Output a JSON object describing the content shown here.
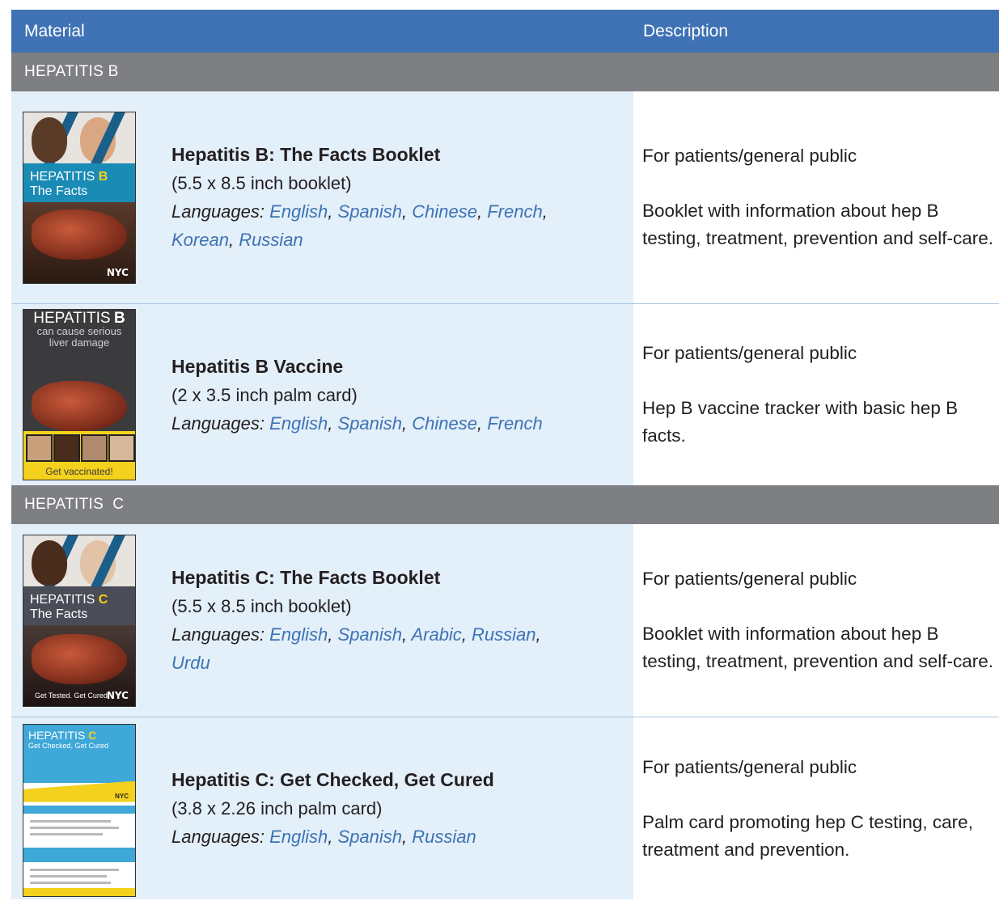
{
  "header": {
    "material": "Material",
    "description": "Description"
  },
  "sections": [
    {
      "label": "HEPATITIS B",
      "rows": [
        {
          "title": "Hepatitis B: The Facts Booklet",
          "format": "(5.5 x 8.5 inch booklet)",
          "languages_label": "Languages:",
          "languages": [
            "English",
            "Spanish",
            "Chinese",
            "French",
            "Korean",
            "Russian"
          ],
          "audience": "For patients/general public",
          "description": "Booklet with information about hep B testing, treatment, prevention and self-care.",
          "thumb": {
            "line1": "HEPATITIS",
            "letter": "B",
            "line2": "The Facts",
            "brand": "NYC"
          }
        },
        {
          "title": "Hepatitis B Vaccine",
          "format": "(2 x 3.5 inch palm card)",
          "languages_label": "Languages:",
          "languages": [
            "English",
            "Spanish",
            "Chinese",
            "French"
          ],
          "audience": "For patients/general public",
          "description": "Hep B vaccine tracker with basic hep B facts.",
          "thumb": {
            "line1": "HEPATITIS",
            "letter": "B",
            "line2": "can cause serious",
            "line3": "liver damage",
            "footer": "Get vaccinated!"
          }
        }
      ]
    },
    {
      "label": "HEPATITIS  C",
      "rows": [
        {
          "title": "Hepatitis C: The Facts Booklet",
          "format": "(5.5 x 8.5 inch booklet)",
          "languages_label": "Languages:",
          "languages": [
            "English",
            "Spanish",
            "Arabic",
            "Russian",
            "Urdu"
          ],
          "audience": "For patients/general public",
          "description": "Booklet with information about hep B testing, treatment, prevention and self-care.",
          "thumb": {
            "line1": "HEPATITIS",
            "letter": "C",
            "line2": "The Facts",
            "footer": "Get Tested. Get Cured!",
            "brand": "NYC"
          }
        },
        {
          "title": "Hepatitis C: Get Checked, Get Cured",
          "format": "(3.8 x 2.26 inch palm card)",
          "languages_label": "Languages:",
          "languages": [
            "English",
            "Spanish",
            "Russian"
          ],
          "audience": "For patients/general public",
          "description": "Palm card promoting hep C testing, care, treatment and prevention.",
          "thumb": {
            "line1": "HEPATITIS",
            "letter": "C",
            "line2": "Get Checked, Get Cured",
            "brand": "NYC"
          }
        }
      ]
    }
  ],
  "colors": {
    "header": "#3e72b4",
    "section": "#7d7f82",
    "material_bg": "#e3eff9",
    "link": "#3e72b4"
  }
}
